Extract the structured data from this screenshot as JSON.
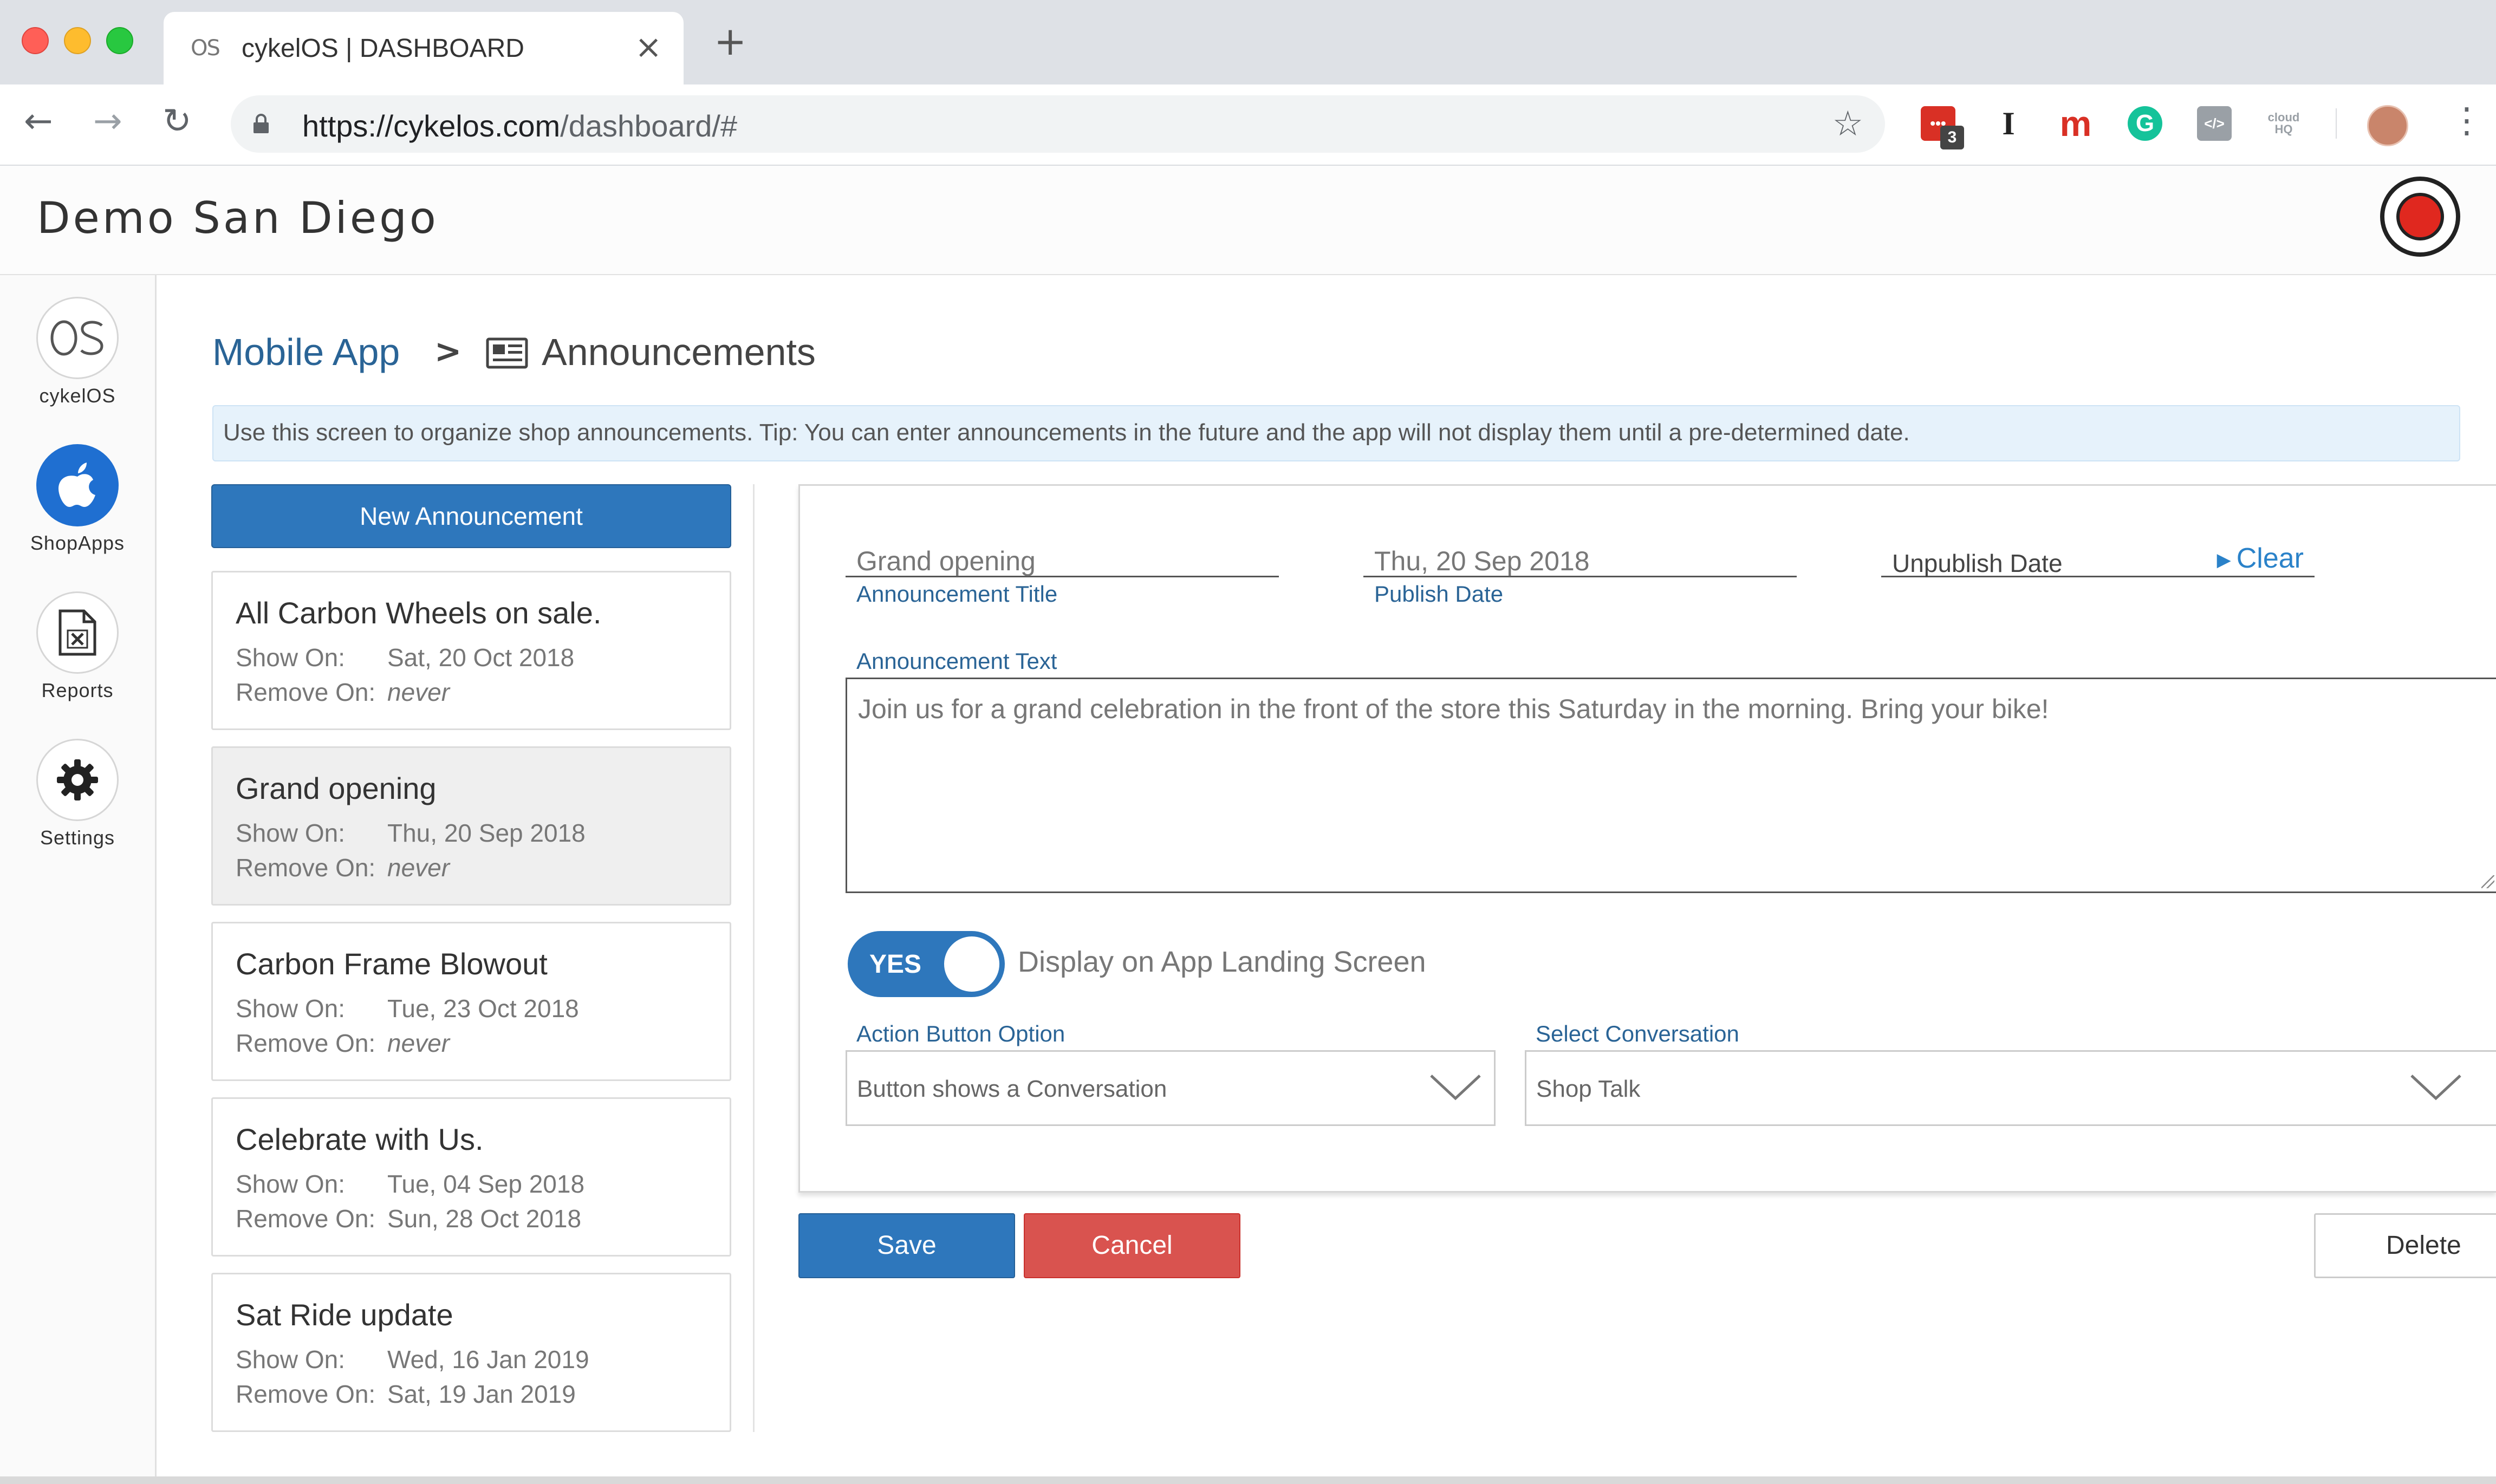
{
  "browser": {
    "tab_title": "cykelOS | DASHBOARD",
    "tab_favicon_text": "OS",
    "url_domain": "https://cykelos.com",
    "url_path": "/dashboard/#",
    "extension_badge": "3",
    "ext_instapaper": "I",
    "ext_m": "m",
    "ext_grammarly": "G",
    "ext_code": "</>",
    "ext_cloudhq": "cloud HQ"
  },
  "header": {
    "title": "Demo San Diego"
  },
  "sidebar": {
    "items": [
      {
        "label": "cykelOS",
        "icon": "os-logo-icon"
      },
      {
        "label": "ShopApps",
        "icon": "apple-icon"
      },
      {
        "label": "Reports",
        "icon": "excel-file-icon"
      },
      {
        "label": "Settings",
        "icon": "gear-icon"
      }
    ]
  },
  "breadcrumb": {
    "parent": "Mobile App",
    "current": "Announcements"
  },
  "tip": "Use this screen to organize shop announcements. Tip: You can enter announcements in the future and the app will not display them until a pre-determined date.",
  "new_button": "New Announcement",
  "announcements": [
    {
      "title": "All Carbon Wheels on sale.",
      "show_label": "Show On:",
      "show_on": "Sat, 20 Oct 2018",
      "remove_label": "Remove On:",
      "remove_on": "never"
    },
    {
      "title": "Grand opening",
      "show_label": "Show On:",
      "show_on": "Thu, 20 Sep 2018",
      "remove_label": "Remove On:",
      "remove_on": "never"
    },
    {
      "title": "Carbon Frame Blowout",
      "show_label": "Show On:",
      "show_on": "Tue, 23 Oct 2018",
      "remove_label": "Remove On:",
      "remove_on": "never"
    },
    {
      "title": "Celebrate with Us.",
      "show_label": "Show On:",
      "show_on": "Tue, 04 Sep 2018",
      "remove_label": "Remove On:",
      "remove_on": "Sun, 28 Oct 2018"
    },
    {
      "title": "Sat Ride update",
      "show_label": "Show On:",
      "show_on": "Wed, 16 Jan 2019",
      "remove_label": "Remove On:",
      "remove_on": "Sat, 19 Jan 2019"
    }
  ],
  "form": {
    "title_value": "Grand opening",
    "title_label": "Announcement Title",
    "publish_value": "Thu, 20 Sep 2018",
    "publish_label": "Publish Date",
    "unpublish_label": "Unpublish Date",
    "clear_label": "Clear",
    "text_label": "Announcement Text",
    "text_value": "Join us for a grand celebration in the front of the store this Saturday in the morning. Bring your bike!",
    "toggle_value": "YES",
    "toggle_label": "Display on App Landing Screen",
    "action_label": "Action Button Option",
    "action_value": "Button shows a Conversation",
    "conversation_label": "Select Conversation",
    "conversation_value": "Shop Talk"
  },
  "buttons": {
    "save": "Save",
    "cancel": "Cancel",
    "delete": "Delete"
  },
  "colors": {
    "primary": "#2e77bc",
    "danger": "#d9534f",
    "link": "#2a6496"
  }
}
